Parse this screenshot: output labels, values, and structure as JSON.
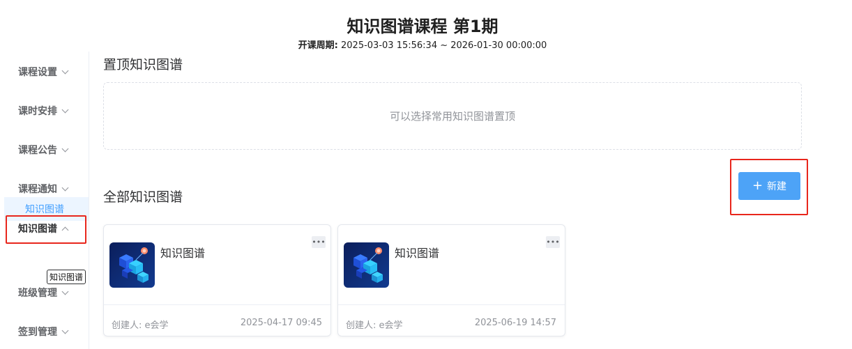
{
  "header": {
    "title": "知识图谱课程 第1期",
    "period_label": "开课周期:",
    "period_value": "2025-03-03 15:56:34 ~ 2026-01-30 00:00:00"
  },
  "sidebar": {
    "items": [
      {
        "label": "课程设置"
      },
      {
        "label": "课时安排"
      },
      {
        "label": "课程公告"
      },
      {
        "label": "课程通知"
      },
      {
        "label": "知识图谱"
      },
      {
        "label": "班级管理"
      },
      {
        "label": "签到管理"
      }
    ],
    "sub_item": "知识图谱",
    "tooltip": "知识图谱"
  },
  "main": {
    "pinned_title": "置顶知识图谱",
    "pinned_placeholder": "可以选择常用知识图谱置顶",
    "all_title": "全部知识图谱",
    "new_button": "新建",
    "new_icon": "plus-icon",
    "cards": [
      {
        "name": "知识图谱",
        "more": "•••",
        "creator": "创建人: e会学",
        "date": "2025-04-17 09:45"
      },
      {
        "name": "知识图谱",
        "more": "•••",
        "creator": "创建人: e会学",
        "date": "2025-06-19 14:57"
      }
    ]
  },
  "colors": {
    "accent": "#409eff",
    "button": "#4da3f7",
    "highlight": "#e8261c"
  }
}
